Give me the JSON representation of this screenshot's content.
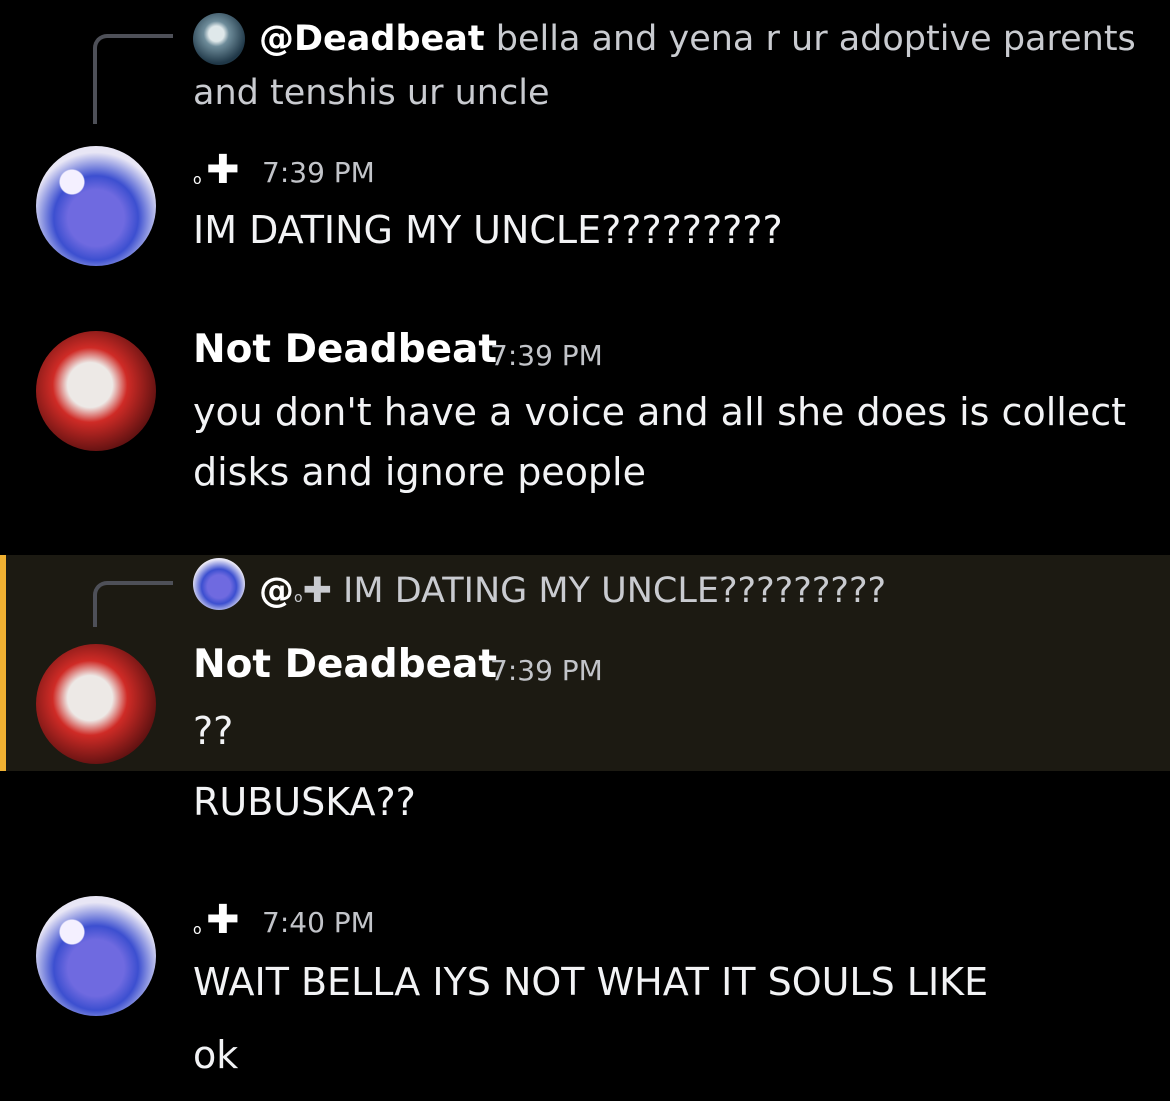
{
  "colors": {
    "background": "#000000",
    "highlight_bg": "#1c1a12",
    "highlight_bar": "#f0b132",
    "reply_line": "#4e5058",
    "muted_text": "#c2c4c9"
  },
  "reply1": {
    "author": "@Deadbeat",
    "text_line1": "bella and yena r ur adoptive parents",
    "text_line2": "and tenshis ur uncle"
  },
  "msg1": {
    "name_glyph": "✚",
    "name_dot": "o",
    "time": "7:39 PM",
    "lines": [
      "IM DATING MY UNCLE?????????"
    ]
  },
  "msg2": {
    "author": "Not Deadbeat",
    "time": "7:39 PM",
    "lines": [
      "you don't have a voice and all she does is collect",
      "disks and ignore people"
    ]
  },
  "reply2": {
    "at": "@",
    "dot": "o",
    "glyph": "✚",
    "text": "IM DATING MY UNCLE?????????"
  },
  "msg3": {
    "author": "Not Deadbeat",
    "time": "7:39 PM",
    "lines": [
      "??",
      "RUBUSKA??"
    ]
  },
  "msg4": {
    "name_glyph": "✚",
    "name_dot": "o",
    "time": "7:40 PM",
    "lines": [
      "WAIT BELLA IYS NOT WHAT IT SOULS LIKE",
      "ok"
    ]
  }
}
